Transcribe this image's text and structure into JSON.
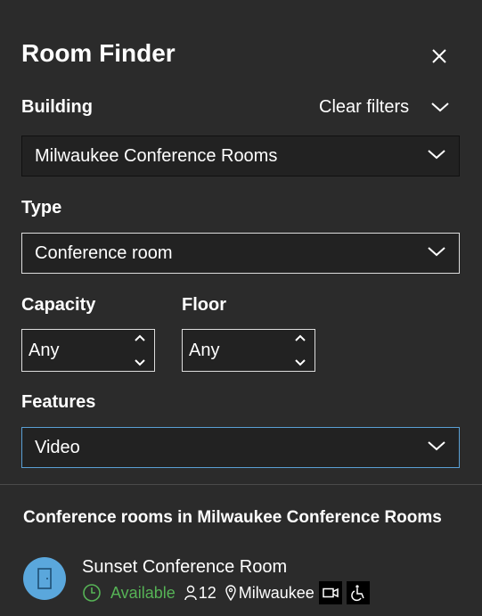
{
  "panel": {
    "title": "Room Finder"
  },
  "filters": {
    "building_label": "Building",
    "clear_filters": "Clear filters",
    "building_value": "Milwaukee Conference Rooms",
    "type_label": "Type",
    "type_value": "Conference room",
    "capacity_label": "Capacity",
    "capacity_value": "Any",
    "floor_label": "Floor",
    "floor_value": "Any",
    "features_label": "Features",
    "features_value": "Video"
  },
  "results": {
    "heading": "Conference rooms in Milwaukee Conference Rooms",
    "rooms": [
      {
        "name": "Sunset Conference Room",
        "status": "Available",
        "capacity": "12",
        "location": "Milwaukee",
        "features": [
          "video-icon",
          "accessibility-icon"
        ]
      }
    ]
  },
  "colors": {
    "background": "#2b2b2b",
    "available": "#56b356",
    "avatar": "#5aa7dc",
    "features_border": "#5a9fd4"
  },
  "icons": [
    "close-icon",
    "chevron-up-icon",
    "chevron-down-icon",
    "door-icon",
    "clock-icon",
    "person-icon",
    "location-pin-icon",
    "video-icon",
    "accessibility-icon"
  ]
}
